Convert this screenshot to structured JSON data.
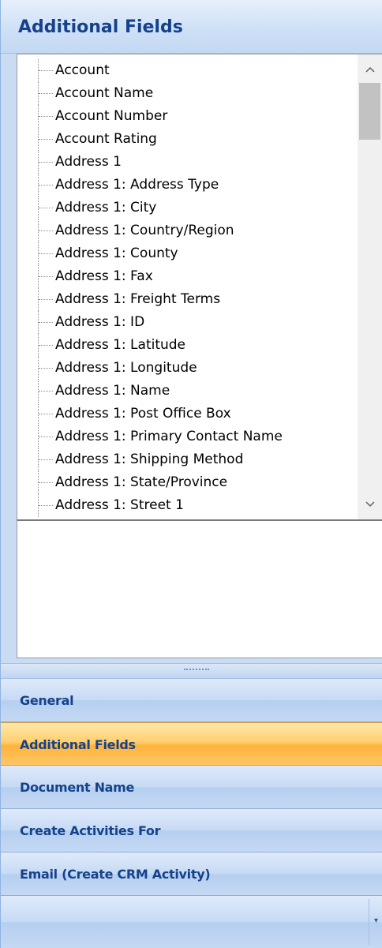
{
  "header": {
    "title": "Additional Fields"
  },
  "tree": {
    "items": [
      "Account",
      "Account Name",
      "Account Number",
      "Account Rating",
      "Address 1",
      "Address 1: Address Type",
      "Address 1: City",
      "Address 1: Country/Region",
      "Address 1: County",
      "Address 1: Fax",
      "Address 1: Freight Terms",
      "Address 1: ID",
      "Address 1: Latitude",
      "Address 1: Longitude",
      "Address 1: Name",
      "Address 1: Post Office Box",
      "Address 1: Primary Contact Name",
      "Address 1: Shipping Method",
      "Address 1: State/Province",
      "Address 1: Street 1"
    ]
  },
  "scrollbar": {
    "up_icon": "chevron-up-icon",
    "down_icon": "chevron-down-icon"
  },
  "nav": {
    "buttons": [
      {
        "label": "General",
        "active": false
      },
      {
        "label": "Additional Fields",
        "active": true
      },
      {
        "label": "Document Name",
        "active": false
      },
      {
        "label": "Create Activities For",
        "active": false
      },
      {
        "label": "Email (Create CRM Activity)",
        "active": false
      }
    ]
  },
  "colors": {
    "accent": "#15428b",
    "active": "#ffc765",
    "panel": "#c9dcf2"
  }
}
